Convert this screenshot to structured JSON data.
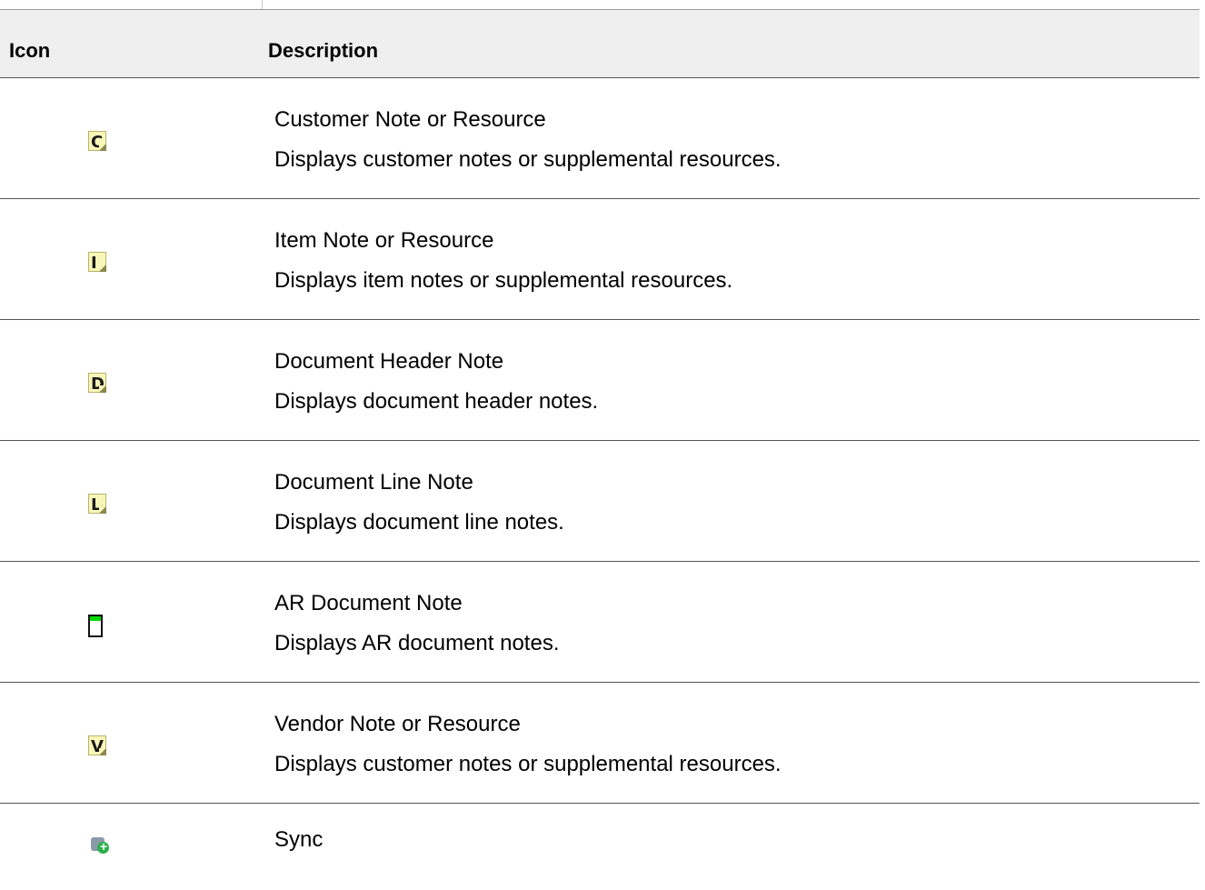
{
  "header": {
    "icon_col": "Icon",
    "desc_col": "Description"
  },
  "rows": [
    {
      "icon": "customer-note-icon",
      "letter": "C",
      "title": "Customer Note or Resource",
      "desc": "Displays customer notes or supplemental resources."
    },
    {
      "icon": "item-note-icon",
      "letter": "I",
      "title": "Item Note or Resource",
      "desc": "Displays item notes or supplemental resources."
    },
    {
      "icon": "document-header-note-icon",
      "letter": "D",
      "title": "Document Header Note",
      "desc": "Displays document header notes."
    },
    {
      "icon": "document-line-note-icon",
      "letter": "L",
      "title": "Document Line Note",
      "desc": "Displays document line notes."
    },
    {
      "icon": "ar-document-note-icon",
      "title": "AR Document Note",
      "desc": "Displays AR document notes."
    },
    {
      "icon": "vendor-note-icon",
      "letter": "V",
      "title": "Vendor Note or Resource",
      "desc": "Displays customer notes or supplemental resources."
    },
    {
      "icon": "sync-icon",
      "title": "Sync"
    }
  ]
}
